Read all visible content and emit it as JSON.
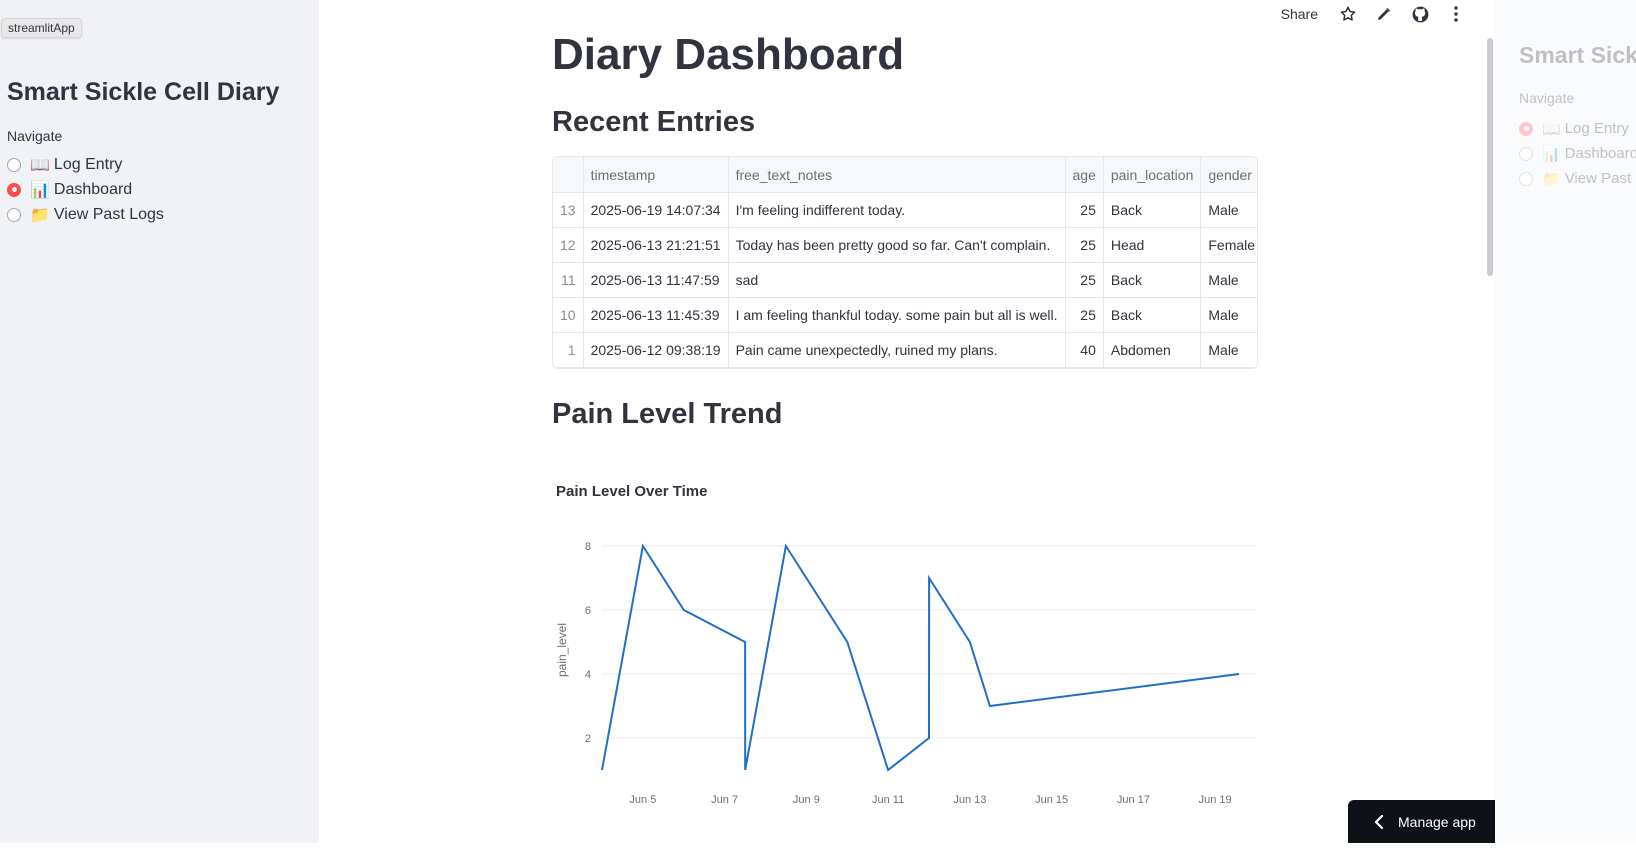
{
  "tooltip": "streamlitApp",
  "sidebar": {
    "title": "Smart Sickle Cell Diary",
    "nav_label": "Navigate",
    "items": [
      {
        "emoji": "📖",
        "label": "Log Entry",
        "selected": false
      },
      {
        "emoji": "📊",
        "label": "Dashboard",
        "selected": true
      },
      {
        "emoji": "📁",
        "label": "View Past Logs",
        "selected": false
      }
    ]
  },
  "toolbar": {
    "share_label": "Share",
    "icons": [
      "star-icon",
      "pencil-icon",
      "github-icon",
      "more-vertical-icon"
    ]
  },
  "main": {
    "title": "Diary Dashboard",
    "recent_heading": "Recent Entries",
    "trend_heading": "Pain Level Trend"
  },
  "table": {
    "columns": [
      "",
      "timestamp",
      "free_text_notes",
      "age",
      "pain_location",
      "gender"
    ],
    "rows": [
      [
        "13",
        "2025-06-19 14:07:34",
        "I'm feeling indifferent today.",
        "25",
        "Back",
        "Male"
      ],
      [
        "12",
        "2025-06-13 21:21:51",
        "Today has been pretty good so far. Can't complain.",
        "25",
        "Head",
        "Female"
      ],
      [
        "11",
        "2025-06-13 11:47:59",
        "sad",
        "25",
        "Back",
        "Male"
      ],
      [
        "10",
        "2025-06-13 11:45:39",
        "I am feeling thankful today. some pain but all is well.",
        "25",
        "Back",
        "Male"
      ],
      [
        "1",
        "2025-06-12 09:38:19",
        "Pain came unexpectedly, ruined my plans.",
        "40",
        "Abdomen",
        "Male"
      ]
    ]
  },
  "chart_data": {
    "type": "line",
    "title": "Pain Level Over Time",
    "xlabel": "",
    "ylabel": "pain_level",
    "x": [
      "2025-06-04",
      "2025-06-05",
      "2025-06-06",
      "2025-06-07 12:00",
      "2025-06-07 12:05",
      "2025-06-08 12:00",
      "2025-06-10",
      "2025-06-11",
      "2025-06-12",
      "2025-06-12 00:05",
      "2025-06-13",
      "2025-06-13 11:45",
      "2025-06-19 14:00"
    ],
    "values": [
      1,
      8,
      6,
      5,
      1,
      8,
      5,
      1,
      2,
      7,
      5,
      3,
      4
    ],
    "ylim": [
      1,
      8.5
    ],
    "yticks": [
      2,
      4,
      6,
      8
    ],
    "xtick_labels": [
      "Jun 5",
      "Jun 7",
      "Jun 9",
      "Jun 11",
      "Jun 13",
      "Jun 15",
      "Jun 17",
      "Jun 19"
    ],
    "xtick_days": [
      5,
      7,
      9,
      11,
      13,
      15,
      17,
      19
    ],
    "x_start_day": 4,
    "x_end_day": 20,
    "grid": true,
    "line_color": "#1f6fc9"
  },
  "manage_app": {
    "label": "Manage app"
  },
  "ghost_sidebar": {
    "title": "Smart Sickle Cell Diary",
    "nav_label": "Navigate",
    "items": [
      {
        "emoji": "📖",
        "label": "Log Entry"
      },
      {
        "emoji": "📊",
        "label": "Dashboard"
      },
      {
        "emoji": "📁",
        "label": "View Past Logs"
      }
    ]
  }
}
